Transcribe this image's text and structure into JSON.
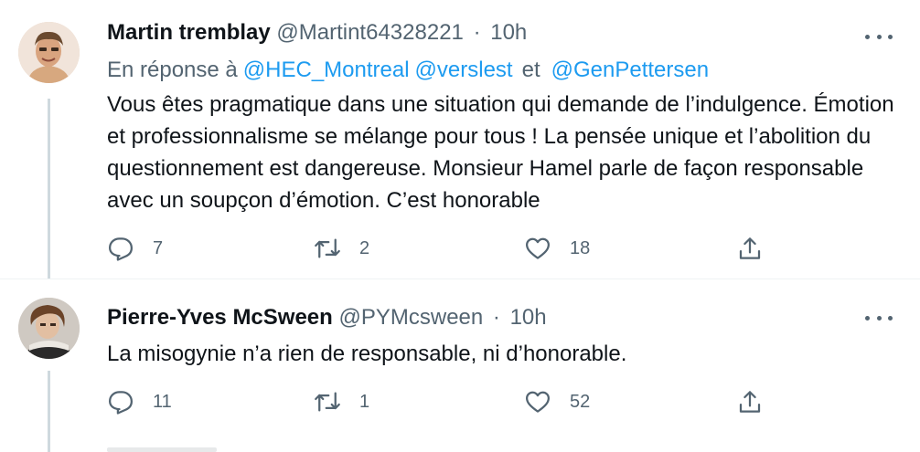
{
  "tweets": [
    {
      "author_name": "Martin tremblay",
      "handle": "@Martint64328221",
      "separator": "·",
      "time": "10h",
      "reply_prefix": "En réponse à",
      "mentions": [
        "@HEC_Montreal",
        "@verslest",
        "@GenPettersen"
      ],
      "mention_conjunction": "et",
      "text": "Vous êtes pragmatique dans une situation qui demande de l’indulgence. Émotion et professionnalisme se mélange pour tous ! La pensée unique et l’abolition du questionnement est dangereuse. Monsieur Hamel parle de façon responsable avec un soupçon d’émotion. C’est honorable",
      "reply_count": "7",
      "retweet_count": "2",
      "like_count": "18"
    },
    {
      "author_name": "Pierre-Yves McSween",
      "handle": "@PYMcsween",
      "separator": "·",
      "time": "10h",
      "text": "La misogynie n’a rien de responsable, ni d’honorable.",
      "reply_count": "11",
      "retweet_count": "1",
      "like_count": "52"
    }
  ],
  "icons": {
    "more": "more-horizontal-icon",
    "reply": "reply-bubble-icon",
    "retweet": "retweet-icon",
    "like": "heart-icon",
    "share": "share-upload-icon"
  },
  "colors": {
    "text": "#0f1419",
    "secondary": "#536471",
    "link": "#1d9bf0",
    "thread_line": "#cfd9de",
    "divider": "#eff3f4"
  }
}
